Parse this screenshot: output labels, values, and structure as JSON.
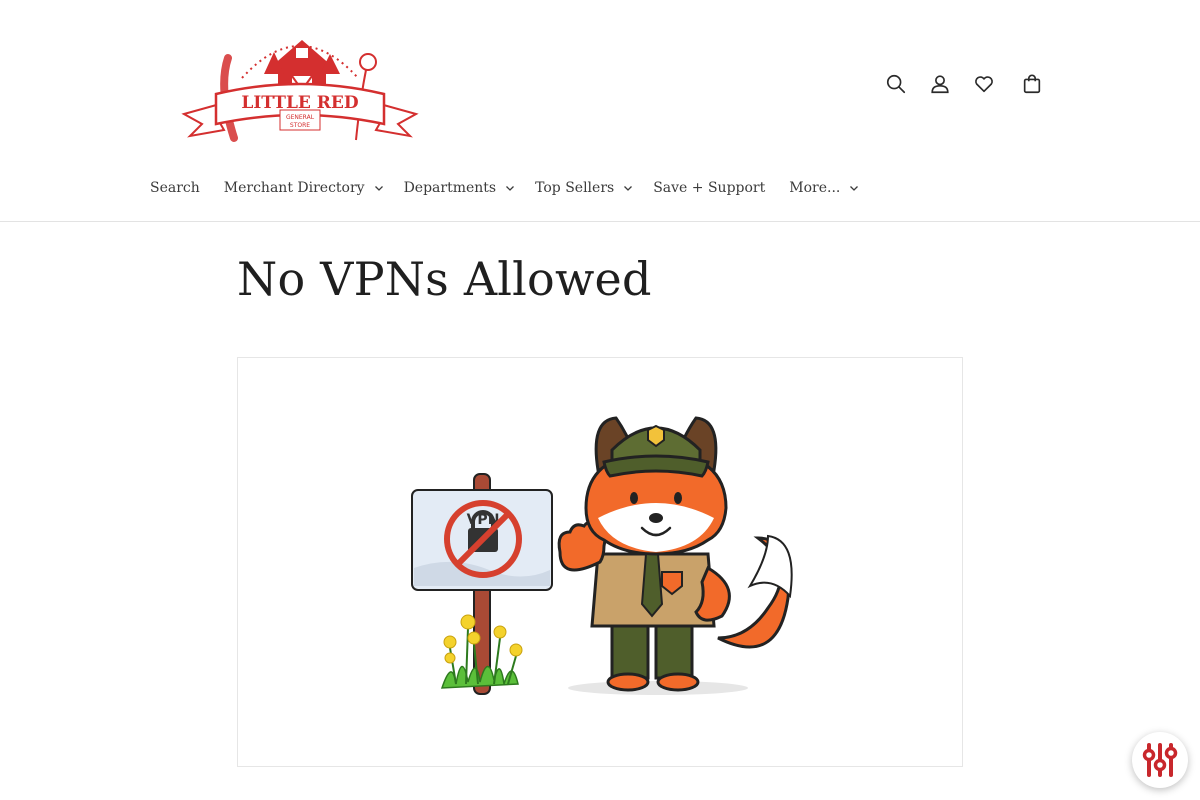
{
  "logo": {
    "line1": "LITTLE RED",
    "line2": "GENERAL",
    "line3": "STORE",
    "brand_color": "#d42f2f"
  },
  "header_icons": [
    "search-icon",
    "account-icon",
    "heart-icon",
    "bag-icon"
  ],
  "nav": {
    "items": [
      {
        "label": "Search"
      },
      {
        "label": "Merchant Directory"
      },
      {
        "label": "Departments"
      },
      {
        "label": "Top Sellers"
      },
      {
        "label": "Save + Support"
      },
      {
        "label": "More..."
      }
    ]
  },
  "page": {
    "title": "No VPNs Allowed"
  },
  "illustration": {
    "sign_text": "VPN",
    "accent": "#f26a2a",
    "uniform": "#4f5e2b"
  },
  "floating_button": {
    "icon": "sliders-icon",
    "color": "#c8272c"
  }
}
